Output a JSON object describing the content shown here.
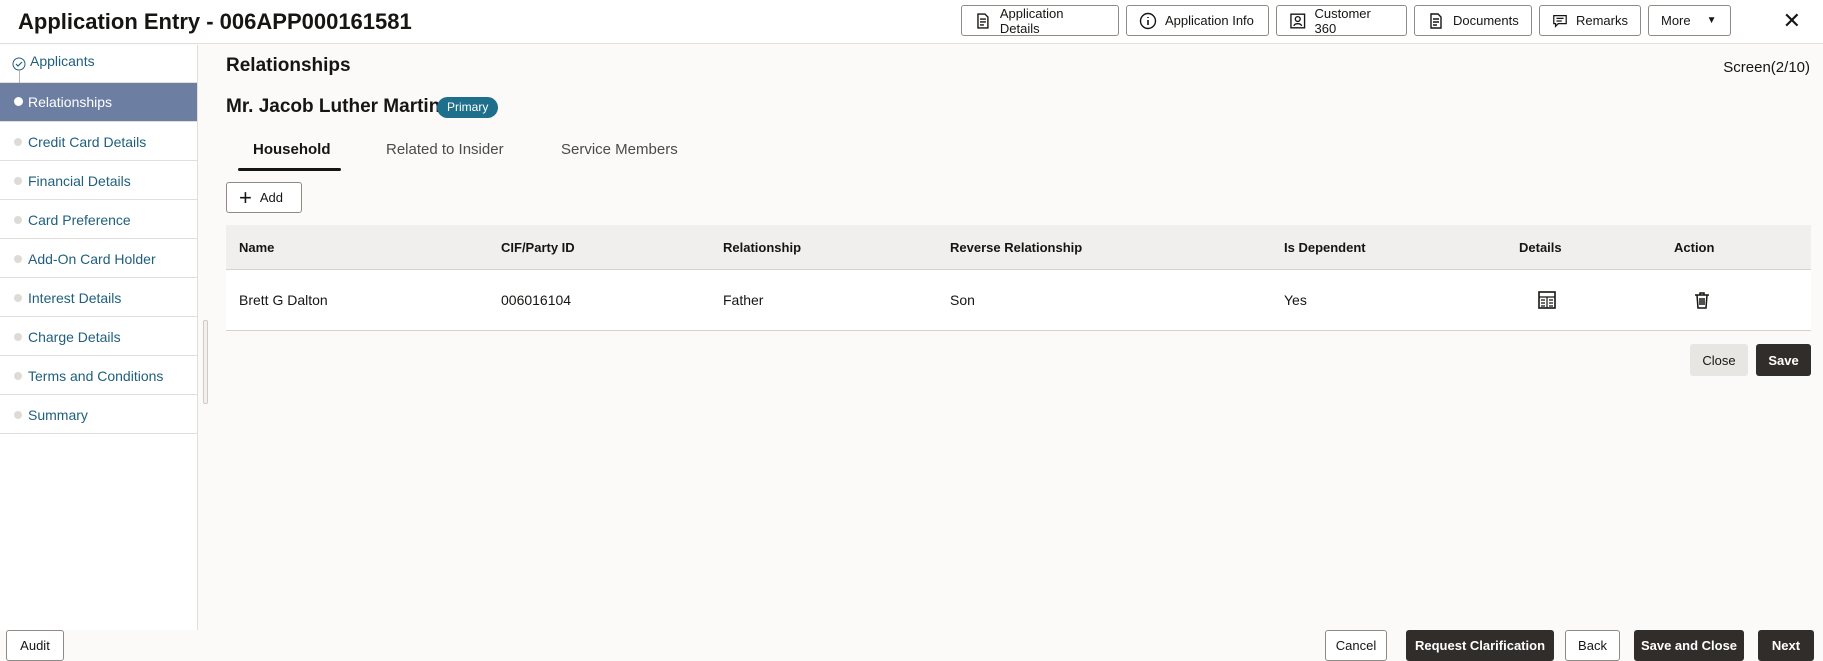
{
  "header": {
    "title": "Application Entry - 006APP000161581",
    "buttons": {
      "application_details": "Application Details",
      "application_info": "Application Info",
      "customer_360": "Customer 360",
      "documents": "Documents",
      "remarks": "Remarks",
      "more": "More"
    },
    "close_symbol": "✕"
  },
  "sidebar": {
    "items": [
      {
        "label": "Applicants",
        "state": "completed"
      },
      {
        "label": "Relationships",
        "state": "active"
      },
      {
        "label": "Credit Card Details",
        "state": "pending"
      },
      {
        "label": "Financial Details",
        "state": "pending"
      },
      {
        "label": "Card Preference",
        "state": "pending"
      },
      {
        "label": "Add-On Card Holder",
        "state": "pending"
      },
      {
        "label": "Interest Details",
        "state": "pending"
      },
      {
        "label": "Charge Details",
        "state": "pending"
      },
      {
        "label": "Terms and Conditions",
        "state": "pending"
      },
      {
        "label": "Summary",
        "state": "pending"
      }
    ]
  },
  "main": {
    "title": "Relationships",
    "screen_counter": "Screen(2/10)",
    "applicant_name": "Mr. Jacob Luther Martin",
    "badge": "Primary",
    "tabs": [
      "Household",
      "Related to Insider",
      "Service Members"
    ],
    "active_tab": "Household",
    "add_label": "Add",
    "table": {
      "columns": [
        "Name",
        "CIF/Party ID",
        "Relationship",
        "Reverse Relationship",
        "Is Dependent",
        "Details",
        "Action"
      ],
      "rows": [
        {
          "name": "Brett G Dalton",
          "cif": "006016104",
          "relationship": "Father",
          "reverse": "Son",
          "dependent": "Yes"
        }
      ]
    },
    "close_label": "Close",
    "save_label": "Save"
  },
  "footer": {
    "audit": "Audit",
    "cancel": "Cancel",
    "request_clarification": "Request Clarification",
    "back": "Back",
    "save_and_close": "Save and Close",
    "next": "Next"
  },
  "colors": {
    "active_nav": "#6c7fa3",
    "badge": "#1d6f8c",
    "primary_button": "#312d2a",
    "link_text": "#1f5f7d"
  }
}
